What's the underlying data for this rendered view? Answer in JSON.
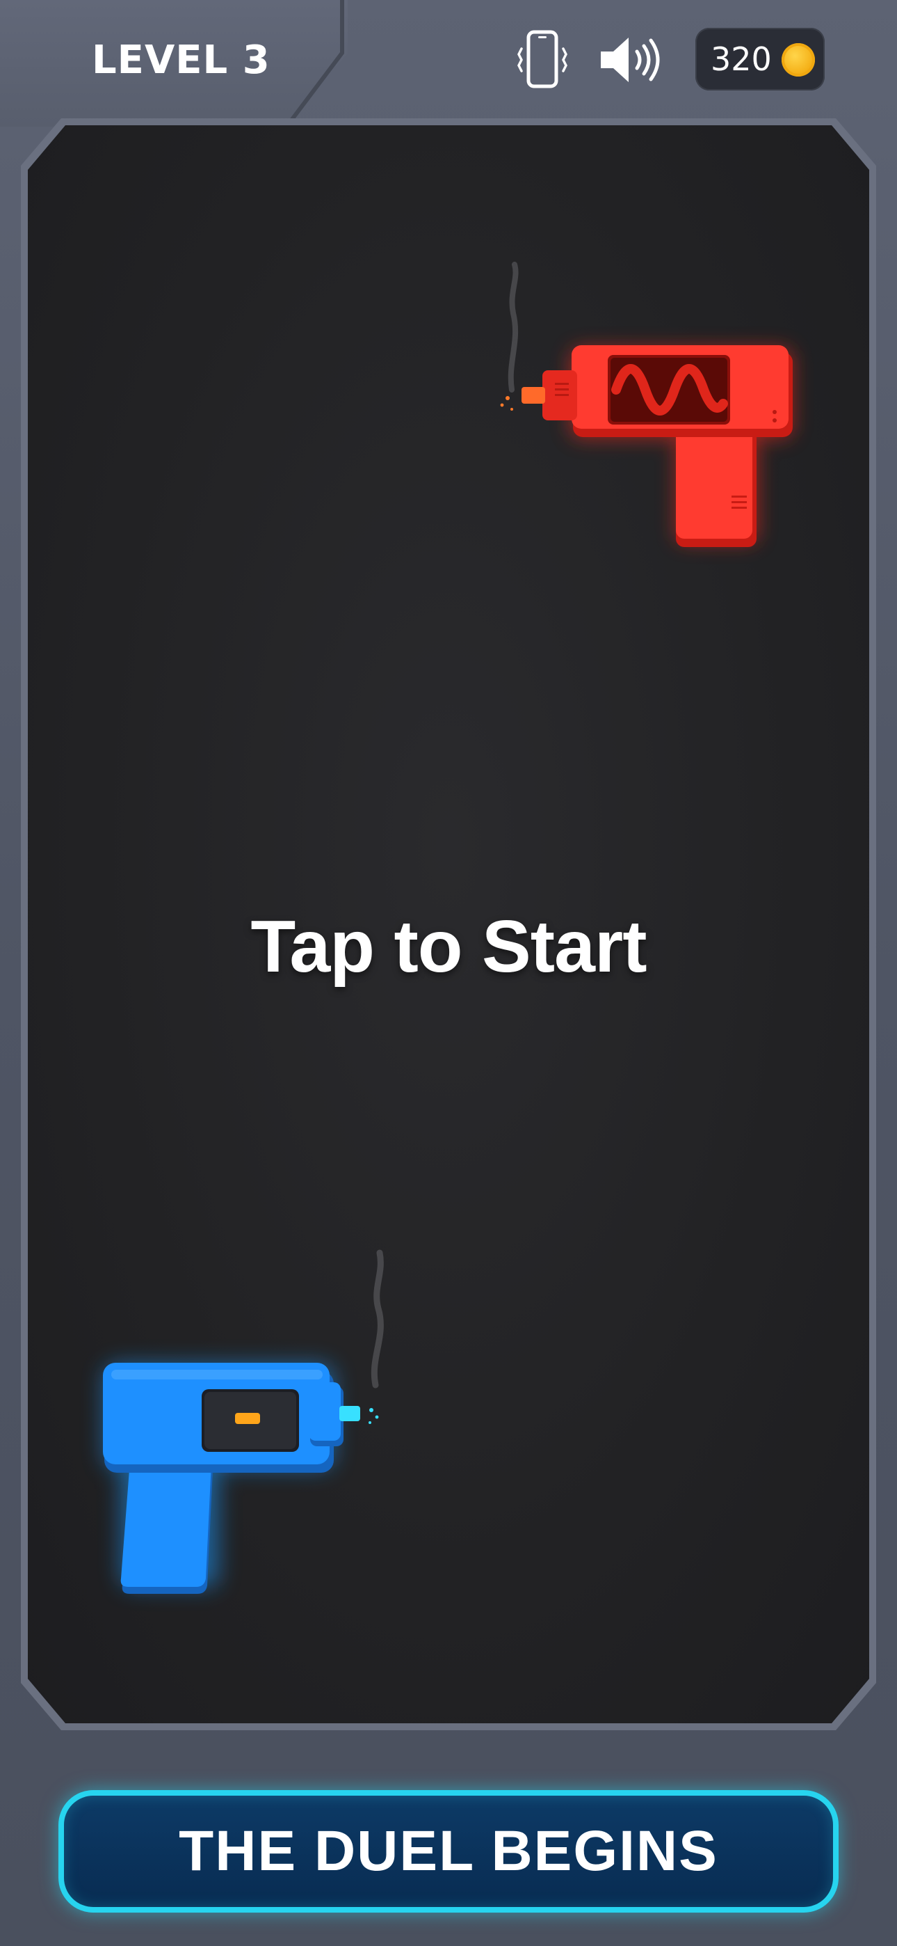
{
  "header": {
    "level_label": "LEVEL 3",
    "vibration_icon": "phone-vibrate-icon",
    "sound_icon": "speaker-on-icon",
    "coins": "320",
    "coin_icon": "gold-coin-icon"
  },
  "game": {
    "prompt": "Tap to Start",
    "enemy": {
      "name": "red-blaster",
      "color": "#ff3b30"
    },
    "player": {
      "name": "blue-blaster",
      "color": "#1e90ff"
    }
  },
  "footer": {
    "button_label": "THE DUEL BEGINS",
    "accent_color": "#27d4ef"
  }
}
